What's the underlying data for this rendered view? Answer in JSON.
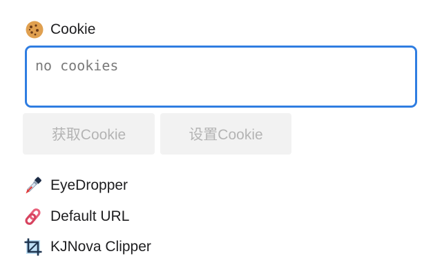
{
  "cookie": {
    "title": "Cookie",
    "icon": "cookie-icon",
    "placeholder": "no cookies",
    "value": "",
    "get_button_label": "获取Cookie",
    "set_button_label": "设置Cookie"
  },
  "tools": {
    "eyedropper": {
      "label": "EyeDropper",
      "icon": "eyedropper-icon"
    },
    "default_url": {
      "label": "Default URL",
      "icon": "link-icon"
    },
    "clipper": {
      "label": "KJNova Clipper",
      "icon": "crop-icon"
    }
  },
  "colors": {
    "focus_border": "#2f7de1",
    "disabled_button_bg": "#f2f2f2",
    "disabled_button_text": "#b4b4b4"
  }
}
